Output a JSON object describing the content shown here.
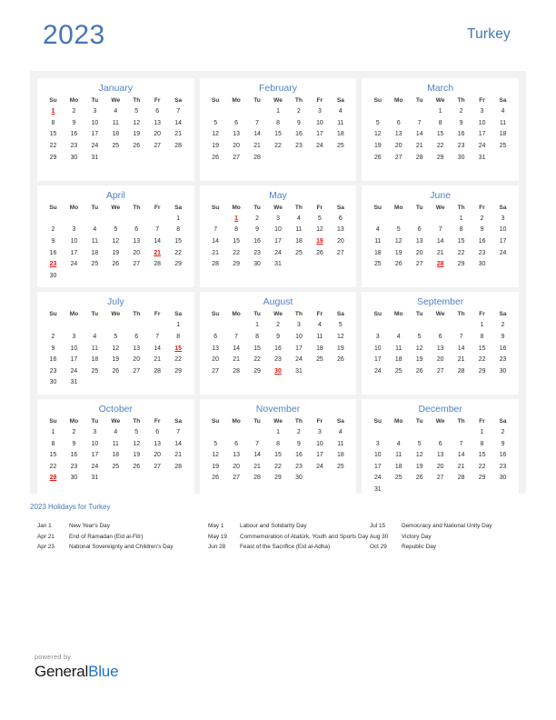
{
  "header": {
    "year": "2023",
    "country": "Turkey"
  },
  "calendar": {
    "weekday_headers": [
      "Su",
      "Mo",
      "Tu",
      "We",
      "Th",
      "Fr",
      "Sa"
    ],
    "months": [
      {
        "name": "January",
        "weeks": [
          [
            "1",
            "2",
            "3",
            "4",
            "5",
            "6",
            "7"
          ],
          [
            "8",
            "9",
            "10",
            "11",
            "12",
            "13",
            "14"
          ],
          [
            "15",
            "16",
            "17",
            "18",
            "19",
            "20",
            "21"
          ],
          [
            "22",
            "23",
            "24",
            "25",
            "26",
            "27",
            "28"
          ],
          [
            "29",
            "30",
            "31",
            "",
            "",
            "",
            ""
          ],
          [
            "",
            "",
            "",
            "",
            "",
            "",
            ""
          ]
        ],
        "holidays": [
          "1"
        ]
      },
      {
        "name": "February",
        "weeks": [
          [
            "",
            "",
            "",
            "1",
            "2",
            "3",
            "4"
          ],
          [
            "5",
            "6",
            "7",
            "8",
            "9",
            "10",
            "11"
          ],
          [
            "12",
            "13",
            "14",
            "15",
            "16",
            "17",
            "18"
          ],
          [
            "19",
            "20",
            "21",
            "22",
            "23",
            "24",
            "25"
          ],
          [
            "26",
            "27",
            "28",
            "",
            "",
            "",
            ""
          ],
          [
            "",
            "",
            "",
            "",
            "",
            "",
            ""
          ]
        ],
        "holidays": []
      },
      {
        "name": "March",
        "weeks": [
          [
            "",
            "",
            "",
            "1",
            "2",
            "3",
            "4"
          ],
          [
            "5",
            "6",
            "7",
            "8",
            "9",
            "10",
            "11"
          ],
          [
            "12",
            "13",
            "14",
            "15",
            "16",
            "17",
            "18"
          ],
          [
            "19",
            "20",
            "21",
            "22",
            "23",
            "24",
            "25"
          ],
          [
            "26",
            "27",
            "28",
            "29",
            "30",
            "31",
            ""
          ],
          [
            "",
            "",
            "",
            "",
            "",
            "",
            ""
          ]
        ],
        "holidays": []
      },
      {
        "name": "April",
        "weeks": [
          [
            "",
            "",
            "",
            "",
            "",
            "",
            "1"
          ],
          [
            "2",
            "3",
            "4",
            "5",
            "6",
            "7",
            "8"
          ],
          [
            "9",
            "10",
            "11",
            "12",
            "13",
            "14",
            "15"
          ],
          [
            "16",
            "17",
            "18",
            "19",
            "20",
            "21",
            "22"
          ],
          [
            "23",
            "24",
            "25",
            "26",
            "27",
            "28",
            "29"
          ],
          [
            "30",
            "",
            "",
            "",
            "",
            "",
            ""
          ]
        ],
        "holidays": [
          "21",
          "23"
        ]
      },
      {
        "name": "May",
        "weeks": [
          [
            "",
            "1",
            "2",
            "3",
            "4",
            "5",
            "6"
          ],
          [
            "7",
            "8",
            "9",
            "10",
            "11",
            "12",
            "13"
          ],
          [
            "14",
            "15",
            "16",
            "17",
            "18",
            "19",
            "20"
          ],
          [
            "21",
            "22",
            "23",
            "24",
            "25",
            "26",
            "27"
          ],
          [
            "28",
            "29",
            "30",
            "31",
            "",
            "",
            ""
          ],
          [
            "",
            "",
            "",
            "",
            "",
            "",
            ""
          ]
        ],
        "holidays": [
          "1",
          "19"
        ]
      },
      {
        "name": "June",
        "weeks": [
          [
            "",
            "",
            "",
            "",
            "1",
            "2",
            "3"
          ],
          [
            "4",
            "5",
            "6",
            "7",
            "8",
            "9",
            "10"
          ],
          [
            "11",
            "12",
            "13",
            "14",
            "15",
            "16",
            "17"
          ],
          [
            "18",
            "19",
            "20",
            "21",
            "22",
            "23",
            "24"
          ],
          [
            "25",
            "26",
            "27",
            "28",
            "29",
            "30",
            ""
          ],
          [
            "",
            "",
            "",
            "",
            "",
            "",
            ""
          ]
        ],
        "holidays": [
          "28"
        ]
      },
      {
        "name": "July",
        "weeks": [
          [
            "",
            "",
            "",
            "",
            "",
            "",
            "1"
          ],
          [
            "2",
            "3",
            "4",
            "5",
            "6",
            "7",
            "8"
          ],
          [
            "9",
            "10",
            "11",
            "12",
            "13",
            "14",
            "15"
          ],
          [
            "16",
            "17",
            "18",
            "19",
            "20",
            "21",
            "22"
          ],
          [
            "23",
            "24",
            "25",
            "26",
            "27",
            "28",
            "29"
          ],
          [
            "30",
            "31",
            "",
            "",
            "",
            "",
            ""
          ]
        ],
        "holidays": [
          "15"
        ]
      },
      {
        "name": "August",
        "weeks": [
          [
            "",
            "",
            "1",
            "2",
            "3",
            "4",
            "5"
          ],
          [
            "6",
            "7",
            "8",
            "9",
            "10",
            "11",
            "12"
          ],
          [
            "13",
            "14",
            "15",
            "16",
            "17",
            "18",
            "19"
          ],
          [
            "20",
            "21",
            "22",
            "23",
            "24",
            "25",
            "26"
          ],
          [
            "27",
            "28",
            "29",
            "30",
            "31",
            "",
            ""
          ],
          [
            "",
            "",
            "",
            "",
            "",
            "",
            ""
          ]
        ],
        "holidays": [
          "30"
        ]
      },
      {
        "name": "September",
        "weeks": [
          [
            "",
            "",
            "",
            "",
            "",
            "1",
            "2"
          ],
          [
            "3",
            "4",
            "5",
            "6",
            "7",
            "8",
            "9"
          ],
          [
            "10",
            "11",
            "12",
            "13",
            "14",
            "15",
            "16"
          ],
          [
            "17",
            "18",
            "19",
            "20",
            "21",
            "22",
            "23"
          ],
          [
            "24",
            "25",
            "26",
            "27",
            "28",
            "29",
            "30"
          ],
          [
            "",
            "",
            "",
            "",
            "",
            "",
            ""
          ]
        ],
        "holidays": []
      },
      {
        "name": "October",
        "weeks": [
          [
            "1",
            "2",
            "3",
            "4",
            "5",
            "6",
            "7"
          ],
          [
            "8",
            "9",
            "10",
            "11",
            "12",
            "13",
            "14"
          ],
          [
            "15",
            "16",
            "17",
            "18",
            "19",
            "20",
            "21"
          ],
          [
            "22",
            "23",
            "24",
            "25",
            "26",
            "27",
            "28"
          ],
          [
            "29",
            "30",
            "31",
            "",
            "",
            "",
            ""
          ],
          [
            "",
            "",
            "",
            "",
            "",
            "",
            ""
          ]
        ],
        "holidays": [
          "29"
        ]
      },
      {
        "name": "November",
        "weeks": [
          [
            "",
            "",
            "",
            "1",
            "2",
            "3",
            "4"
          ],
          [
            "5",
            "6",
            "7",
            "8",
            "9",
            "10",
            "11"
          ],
          [
            "12",
            "13",
            "14",
            "15",
            "16",
            "17",
            "18"
          ],
          [
            "19",
            "20",
            "21",
            "22",
            "23",
            "24",
            "25"
          ],
          [
            "26",
            "27",
            "28",
            "29",
            "30",
            "",
            ""
          ],
          [
            "",
            "",
            "",
            "",
            "",
            "",
            ""
          ]
        ],
        "holidays": []
      },
      {
        "name": "December",
        "weeks": [
          [
            "",
            "",
            "",
            "",
            "",
            "1",
            "2"
          ],
          [
            "3",
            "4",
            "5",
            "6",
            "7",
            "8",
            "9"
          ],
          [
            "10",
            "11",
            "12",
            "13",
            "14",
            "15",
            "16"
          ],
          [
            "17",
            "18",
            "19",
            "20",
            "21",
            "22",
            "23"
          ],
          [
            "24",
            "25",
            "26",
            "27",
            "28",
            "29",
            "30"
          ],
          [
            "31",
            "",
            "",
            "",
            "",
            "",
            ""
          ]
        ],
        "holidays": []
      }
    ]
  },
  "holidays_section": {
    "heading": "2023 Holidays for Turkey",
    "columns": [
      [
        {
          "date": "Jan 1",
          "name": "New Year's Day"
        },
        {
          "date": "Apr 21",
          "name": "End of Ramadan (Eid al-Fitr)"
        },
        {
          "date": "Apr 23",
          "name": "National Sovereignty and Children's Day"
        }
      ],
      [
        {
          "date": "May 1",
          "name": "Labour and Solidarity Day"
        },
        {
          "date": "May 19",
          "name": "Commemoration of Atatürk, Youth and Sports Day"
        },
        {
          "date": "Jun 28",
          "name": "Feast of the Sacrifice (Eid al-Adha)"
        }
      ],
      [
        {
          "date": "Jul 15",
          "name": "Democracy and National Unity Day"
        },
        {
          "date": "Aug 30",
          "name": "Victory Day"
        },
        {
          "date": "Oct 29",
          "name": "Republic Day"
        }
      ]
    ]
  },
  "footer": {
    "powered_by": "powered by",
    "brand_first": "General",
    "brand_second": "Blue"
  },
  "colors": {
    "accent_blue": "#4576b5",
    "month_blue": "#4f81c7",
    "holiday_red": "#e8130c",
    "panel_gray": "#f2f2f2",
    "brand_blue": "#1f72c4"
  }
}
